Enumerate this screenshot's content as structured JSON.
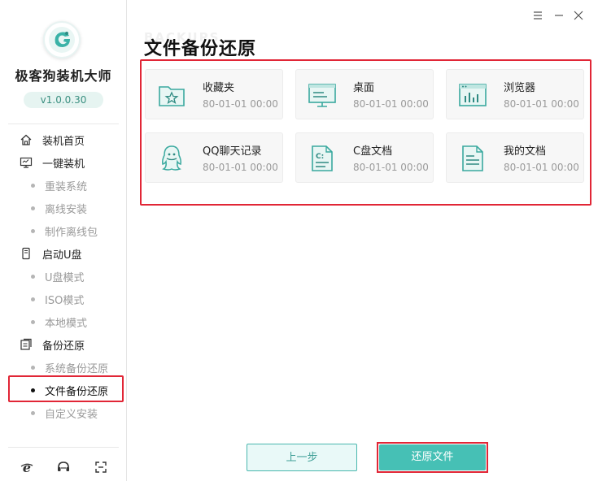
{
  "app": {
    "title": "极客狗装机大师",
    "version": "v1.0.0.30"
  },
  "window_controls": [
    {
      "name": "menu-icon"
    },
    {
      "name": "minimize-icon"
    },
    {
      "name": "close-icon"
    }
  ],
  "sidebar": {
    "groups": [
      {
        "label": "装机首页",
        "icon": "home-icon",
        "subitems": []
      },
      {
        "label": "一键装机",
        "icon": "monitor-icon",
        "subitems": [
          "重装系统",
          "离线安装",
          "制作离线包"
        ]
      },
      {
        "label": "启动U盘",
        "icon": "usb-icon",
        "subitems": [
          "U盘模式",
          "ISO模式",
          "本地模式"
        ]
      },
      {
        "label": "备份还原",
        "icon": "backup-icon",
        "subitems": [
          "系统备份还原",
          "文件备份还原",
          "自定义安装"
        ]
      }
    ],
    "active_item": "文件备份还原",
    "bottom_icons": [
      "browser-icon",
      "chat-support-icon",
      "fullscreen-icon"
    ]
  },
  "main": {
    "ghost_title": "BACKUPS",
    "title": "文件备份还原",
    "items": [
      {
        "name": "收藏夹",
        "date": "80-01-01 00:00",
        "icon": "favorites-folder-icon"
      },
      {
        "name": "桌面",
        "date": "80-01-01 00:00",
        "icon": "desktop-icon"
      },
      {
        "name": "浏览器",
        "date": "80-01-01 00:00",
        "icon": "browser-window-icon"
      },
      {
        "name": "QQ聊天记录",
        "date": "80-01-01 00:00",
        "icon": "qq-icon"
      },
      {
        "name": "C盘文档",
        "date": "80-01-01 00:00",
        "icon": "c-drive-document-icon"
      },
      {
        "name": "我的文档",
        "date": "80-01-01 00:00",
        "icon": "my-document-icon"
      }
    ]
  },
  "buttons": {
    "prev": "上一步",
    "restore": "还原文件"
  },
  "colors": {
    "accent": "#46c0b5",
    "highlight_border": "#e12636"
  }
}
